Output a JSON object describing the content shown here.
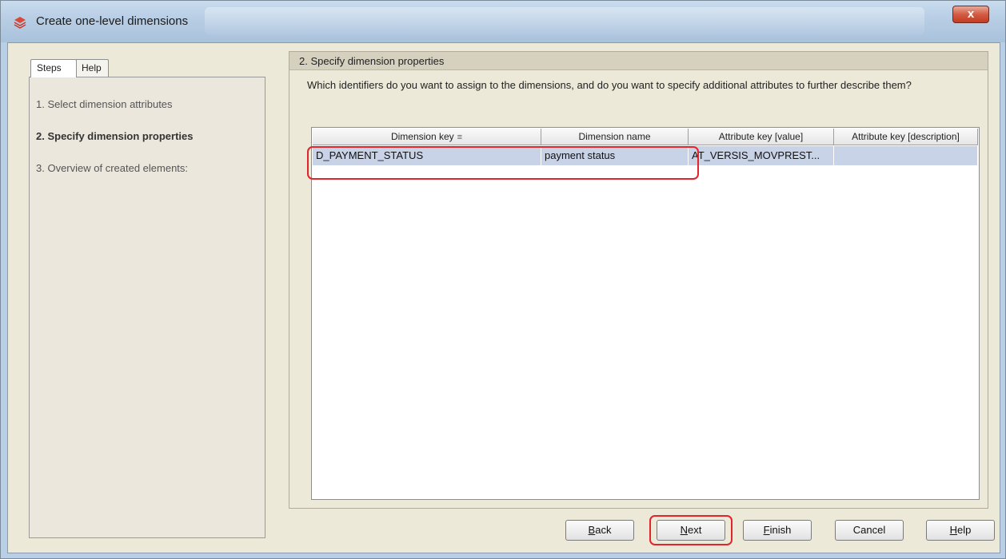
{
  "window": {
    "title": "Create one-level dimensions",
    "close_label": "x"
  },
  "tabs": {
    "steps": "Steps",
    "help": "Help"
  },
  "steps": [
    {
      "label": "1. Select dimension attributes"
    },
    {
      "label": "2. Specify dimension properties"
    },
    {
      "label": "3. Overview of created elements:"
    }
  ],
  "main": {
    "header": "2. Specify dimension properties",
    "question": "Which identifiers do you want to assign to the dimensions, and do you want to specify additional attributes to further describe them?"
  },
  "table": {
    "columns": [
      "Dimension key",
      "Dimension name",
      "Attribute key [value]",
      "Attribute key [description]"
    ],
    "rows": [
      [
        "D_PAYMENT_STATUS",
        "payment status",
        "AT_VERSIS_MOVPREST...",
        ""
      ]
    ]
  },
  "buttons": {
    "back": {
      "mnemonic": "B",
      "rest": "ack"
    },
    "next": {
      "mnemonic": "N",
      "rest": "ext"
    },
    "finish": {
      "mnemonic": "F",
      "rest": "inish"
    },
    "cancel": {
      "label": "Cancel"
    },
    "help": {
      "mnemonic": "H",
      "rest": "elp"
    }
  },
  "colors": {
    "highlight": "#e4242b",
    "selection": "#c9d3e8",
    "panel_bg": "#ece9d8"
  }
}
